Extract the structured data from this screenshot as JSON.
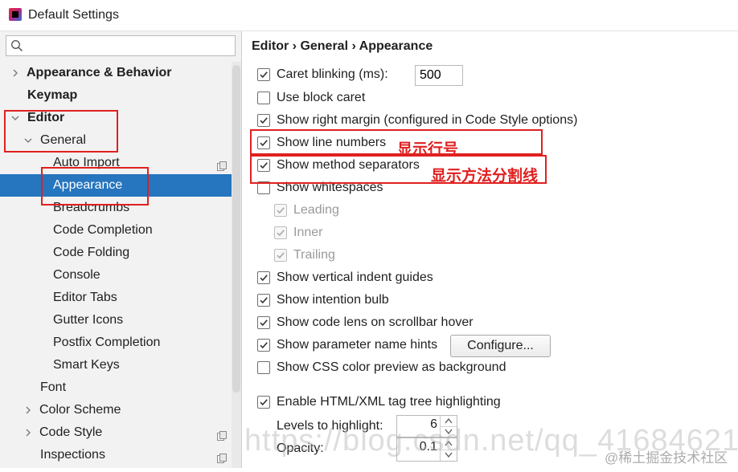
{
  "window": {
    "title": "Default Settings"
  },
  "search": {
    "placeholder": "",
    "icon": "search-icon"
  },
  "sidebar": {
    "items": [
      {
        "label": "Appearance & Behavior",
        "arrow": "right",
        "bold": true
      },
      {
        "label": "Keymap",
        "bold": true
      },
      {
        "label": "Editor",
        "arrow": "down",
        "bold": true
      },
      {
        "label": "General",
        "arrow": "down"
      },
      {
        "label": "Auto Import",
        "copy_icon": true
      },
      {
        "label": "Appearance",
        "selected": true
      },
      {
        "label": "Breadcrumbs"
      },
      {
        "label": "Code Completion"
      },
      {
        "label": "Code Folding"
      },
      {
        "label": "Console"
      },
      {
        "label": "Editor Tabs"
      },
      {
        "label": "Gutter Icons"
      },
      {
        "label": "Postfix Completion"
      },
      {
        "label": "Smart Keys"
      },
      {
        "label": "Font"
      },
      {
        "label": "Color Scheme",
        "arrow": "right"
      },
      {
        "label": "Code Style",
        "arrow": "right",
        "copy_icon": true
      },
      {
        "label": "Inspections",
        "copy_icon": true
      }
    ]
  },
  "breadcrumb": "Editor › General › Appearance",
  "options": [
    {
      "label": "Caret blinking (ms):",
      "checked": true,
      "input_value": "500"
    },
    {
      "label": "Use block caret",
      "checked": false
    },
    {
      "label": "Show right margin (configured in Code Style options)",
      "checked": true
    },
    {
      "label": "Show line numbers",
      "checked": true
    },
    {
      "label": "Show method separators",
      "checked": true
    },
    {
      "label": "Show whitespaces",
      "checked": false
    },
    {
      "label": "Leading",
      "checked": true,
      "disabled": true
    },
    {
      "label": "Inner",
      "checked": true,
      "disabled": true
    },
    {
      "label": "Trailing",
      "checked": true,
      "disabled": true
    },
    {
      "label": "Show vertical indent guides",
      "checked": true
    },
    {
      "label": "Show intention bulb",
      "checked": true
    },
    {
      "label": "Show code lens on scrollbar hover",
      "checked": true
    },
    {
      "label": "Show parameter name hints",
      "checked": true,
      "button": "Configure..."
    },
    {
      "label": "Show CSS color preview as background",
      "checked": false
    },
    {
      "label": "Enable HTML/XML tag tree highlighting",
      "checked": true
    }
  ],
  "levels": {
    "label": "Levels to highlight:",
    "value": "6"
  },
  "opacity": {
    "label": "Opacity:",
    "value": "0.1"
  },
  "annotations": {
    "line_numbers": "显示行号",
    "method_separators": "显示方法分割线"
  },
  "watermark": {
    "url": "https://blog.csdn.net/qq_41684621",
    "site": "@稀土掘金技术社区"
  },
  "colors": {
    "selection": "#2675bf",
    "annotation": "#e02020"
  }
}
